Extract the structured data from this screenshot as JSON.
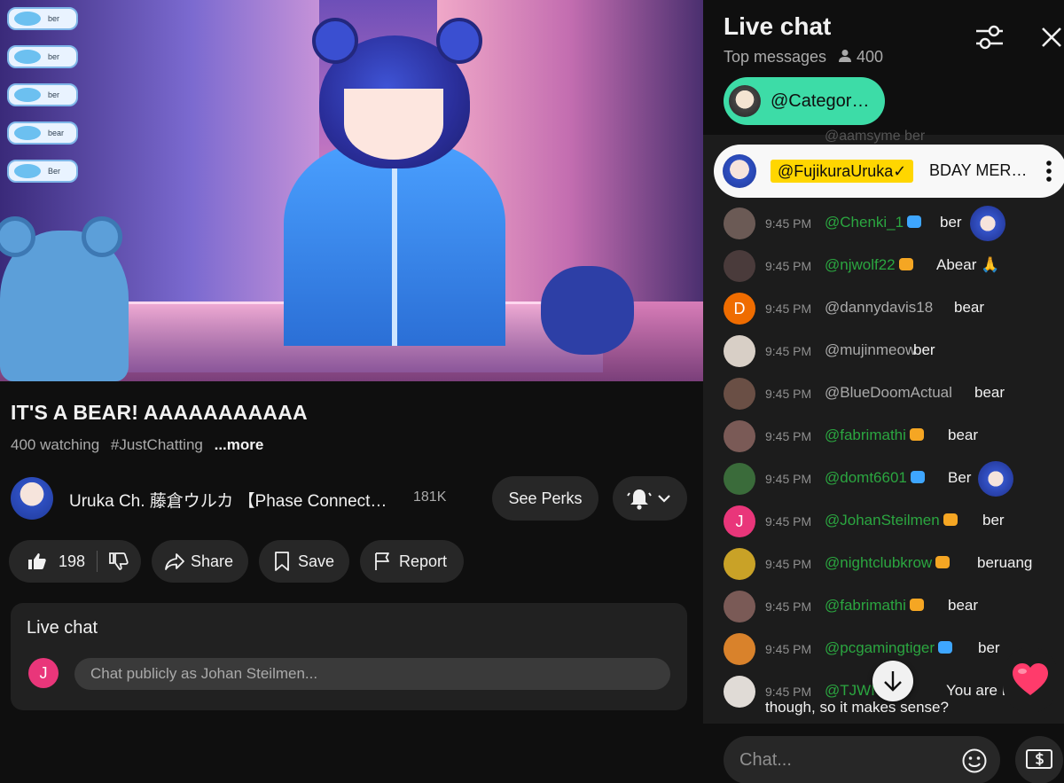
{
  "video": {
    "stickers": [
      "ber",
      "ber",
      "ber",
      "bear",
      "Ber"
    ]
  },
  "title": "IT'S A BEAR! AAAAAAAAAAA",
  "meta": {
    "watching": "400 watching",
    "tag": "#JustChatting",
    "more": "...more"
  },
  "channel": {
    "name": "Uruka Ch. 藤倉ウルカ 【Phase Connect…",
    "subs": "181K",
    "perks_label": "See Perks"
  },
  "actions": {
    "likes": "198",
    "share": "Share",
    "save": "Save",
    "report": "Report"
  },
  "chat_card": {
    "title": "Live chat",
    "avatar_letter": "J",
    "placeholder": "Chat publicly as Johan Steilmen..."
  },
  "panel": {
    "title": "Live chat",
    "mode": "Top messages",
    "viewers": "400",
    "category": "@Categor…",
    "ghost_row": "@aamsyme  ber",
    "pinned": {
      "author": "@FujikuraUruka✓",
      "message": "BDAY MERC…"
    },
    "messages": [
      {
        "time": "9:45 PM",
        "author": "@Chenki_1",
        "text": "ber",
        "avatar_letter": "",
        "avatar_color": "#6b5a55",
        "author_color": "#2ba640",
        "badge_color": "#3ea6ff",
        "emote": true
      },
      {
        "time": "9:45 PM",
        "author": "@njwolf22",
        "text": "Abear 🙏",
        "avatar_letter": "",
        "avatar_color": "#4a3b3b",
        "author_color": "#2ba640",
        "badge_color": "#f5a623",
        "emote": false
      },
      {
        "time": "9:45 PM",
        "author": "@dannydavis18",
        "text": "bear",
        "avatar_letter": "D",
        "avatar_color": "#ef6c00",
        "author_color": "#aaaaaa",
        "badge_color": "",
        "emote": false
      },
      {
        "time": "9:45 PM",
        "author": "@mujinmeow",
        "text": "ber",
        "avatar_letter": "",
        "avatar_color": "#d8cfc6",
        "author_color": "#aaaaaa",
        "badge_color": "",
        "emote": false
      },
      {
        "time": "9:45 PM",
        "author": "@BlueDoomActual",
        "text": "bear",
        "avatar_letter": "",
        "avatar_color": "#6a4f45",
        "author_color": "#aaaaaa",
        "badge_color": "",
        "emote": false
      },
      {
        "time": "9:45 PM",
        "author": "@fabrimathi",
        "text": "bear",
        "avatar_letter": "",
        "avatar_color": "#7a5a56",
        "author_color": "#2ba640",
        "badge_color": "#f5a623",
        "emote": false
      },
      {
        "time": "9:45 PM",
        "author": "@domt6601",
        "text": "Ber",
        "avatar_letter": "",
        "avatar_color": "#3a6b3a",
        "author_color": "#2ba640",
        "badge_color": "#3ea6ff",
        "emote": true
      },
      {
        "time": "9:45 PM",
        "author": "@JohanSteilmen",
        "text": "ber",
        "avatar_letter": "J",
        "avatar_color": "#e9367a",
        "author_color": "#2ba640",
        "badge_color": "#f5a623",
        "emote": false
      },
      {
        "time": "9:45 PM",
        "author": "@nightclubkrow",
        "text": "beruang",
        "avatar_letter": "",
        "avatar_color": "#c9a227",
        "author_color": "#2ba640",
        "badge_color": "#f5a623",
        "emote": false
      },
      {
        "time": "9:45 PM",
        "author": "@fabrimathi",
        "text": "bear",
        "avatar_letter": "",
        "avatar_color": "#7a5a56",
        "author_color": "#2ba640",
        "badge_color": "#f5a623",
        "emote": false
      },
      {
        "time": "9:45 PM",
        "author": "@pcgamingtiger",
        "text": "ber",
        "avatar_letter": "",
        "avatar_color": "#d9822b",
        "author_color": "#2ba640",
        "badge_color": "#3ea6ff",
        "emote": false
      },
      {
        "time": "9:45 PM",
        "author": "@TJWI",
        "text": "You are Bea",
        "avatar_letter": "",
        "avatar_color": "#e0dbd6",
        "author_color": "#2ba640",
        "badge_color": "#f5a623",
        "emote": false
      }
    ],
    "last_line_continued": "though, so it makes sense?",
    "chat_placeholder": "Chat..."
  },
  "colors": {
    "accent_green": "#3ddca7",
    "pinned_tag": "#ffd600",
    "member_name": "#2ba640"
  }
}
